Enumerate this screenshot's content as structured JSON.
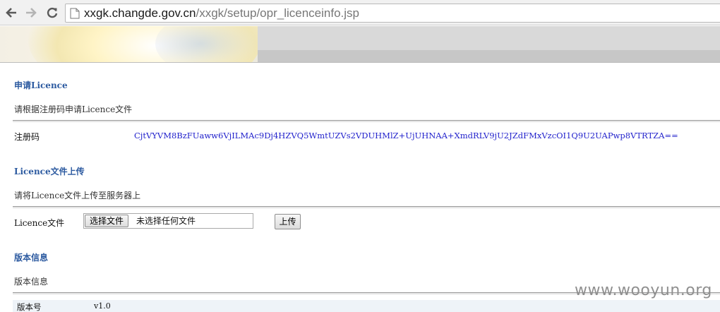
{
  "browser": {
    "url_host": "xxgk.changde.gov.cn",
    "url_path": "/xxgk/setup/opr_licenceinfo.jsp"
  },
  "apply_section": {
    "heading": "申请Licence",
    "description": "请根据注册码申请Licence文件",
    "reg_code_label": "注册码",
    "reg_code_value": "CjtVYVM8BzFUaww6VjILMAc9Dj4HZVQ5WmtUZVs2VDUHMlZ+UjUHNAA+XmdRLV9jU2JZdFMxVzcOI1Q9U2UAPwp8VTRTZA=="
  },
  "upload_section": {
    "heading": "Licence文件上传",
    "description": "请将Licence文件上传至服务器上",
    "file_label": "Licence文件",
    "choose_file_button": "选择文件",
    "file_status": "未选择任何文件",
    "upload_button": "上传"
  },
  "version_section": {
    "heading": "版本信息",
    "description": "版本信息",
    "version_label": "版本号",
    "version_value": "v1.0"
  },
  "watermark": "www.wooyun.org"
}
